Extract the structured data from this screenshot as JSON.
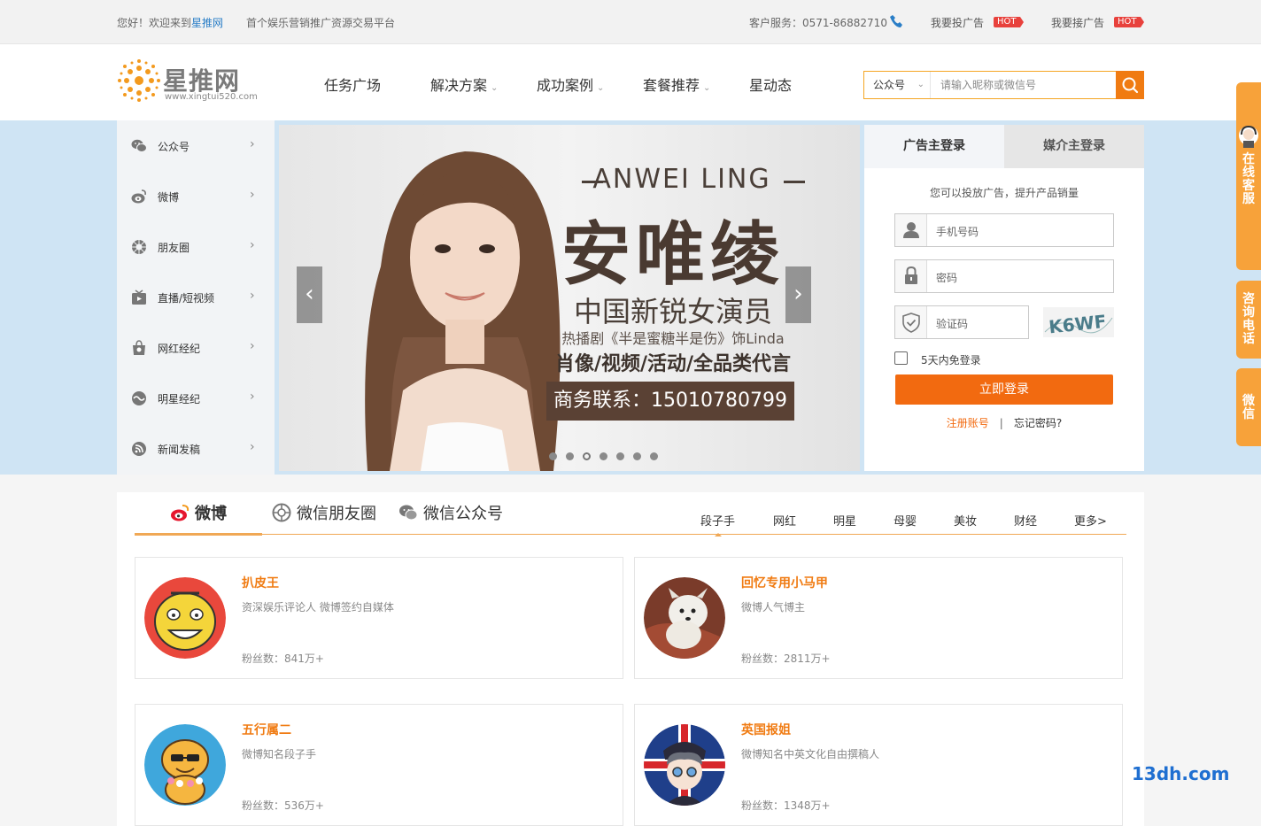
{
  "topbar": {
    "welcome_prefix": "您好！欢迎来到",
    "welcome_brand": "星推网",
    "slogan": "首个娱乐营销推广资源交易平台",
    "service": "客户服务：0571-86882710",
    "link_advertise": "我要投广告",
    "link_receive": "我要接广告",
    "hot_badge": "HOT"
  },
  "header": {
    "logo_name": "星推网",
    "logo_url": "www.xingtui520.com",
    "nav": [
      {
        "label": "任务广场",
        "caret": ""
      },
      {
        "label": "解决方案",
        "caret": "⌄"
      },
      {
        "label": "成功案例",
        "caret": "⌄"
      },
      {
        "label": "套餐推荐",
        "caret": "⌄"
      },
      {
        "label": "星动态",
        "caret": ""
      }
    ],
    "search_select": "公众号",
    "search_placeholder": "请输入昵称或微信号"
  },
  "side_menu": [
    {
      "label": "公众号",
      "icon": "wechat-icon"
    },
    {
      "label": "微博",
      "icon": "weibo-icon"
    },
    {
      "label": "朋友圈",
      "icon": "moments-icon"
    },
    {
      "label": "直播/短视频",
      "icon": "live-video-icon"
    },
    {
      "label": "网红经纪",
      "icon": "bag-icon"
    },
    {
      "label": "明星经纪",
      "icon": "star-agent-icon"
    },
    {
      "label": "新闻发稿",
      "icon": "news-icon"
    }
  ],
  "banner": {
    "english_name": "ANWEI LING",
    "chinese_name": "安唯绫",
    "subtitle": "中国新锐女演员",
    "drama": "热播剧《半是蜜糖半是伤》饰Linda",
    "endorse": "肖像/视频/活动/全品类代言",
    "contact": "商务联系：15010780799",
    "active_slide": 3,
    "slide_count": 7
  },
  "login": {
    "tab_advertiser": "广告主登录",
    "tab_media": "媒介主登录",
    "hint": "您可以投放广告，提升产品销量",
    "phone_placeholder": "手机号码",
    "password_placeholder": "密码",
    "captcha_placeholder": "验证码",
    "captcha_text": "K6WF",
    "remember": "5天内免登录",
    "submit": "立即登录",
    "register": "注册账号",
    "separator": "|",
    "forgot": "忘记密码?"
  },
  "content": {
    "tabs": [
      {
        "label": "微博",
        "icon": "weibo-icon"
      },
      {
        "label": "微信朋友圈",
        "icon": "moments-icon"
      },
      {
        "label": "微信公众号",
        "icon": "wechat-icon"
      }
    ],
    "filters": [
      "段子手",
      "网红",
      "明星",
      "母婴",
      "美妆",
      "财经",
      "更多>"
    ],
    "cards": [
      {
        "name": "扒皮王",
        "desc": "资深娱乐评论人 微博签约自媒体",
        "fans": "粉丝数：841万+"
      },
      {
        "name": "回忆专用小马甲",
        "desc": "微博人气博主",
        "fans": "粉丝数：2811万+"
      },
      {
        "name": "五行属二",
        "desc": "微博知名段子手",
        "fans": "粉丝数：536万+"
      },
      {
        "name": "英国报姐",
        "desc": "微博知名中英文化自由撰稿人",
        "fans": "粉丝数：1348万+"
      }
    ]
  },
  "float": {
    "online_service": "在线客服",
    "consult_phone": "咨询电话",
    "wechat": "微信"
  },
  "watermark": "13dh.com",
  "colors": {
    "accent": "#f26a10",
    "band": "#cfe4f4",
    "float": "#f7a23a"
  }
}
